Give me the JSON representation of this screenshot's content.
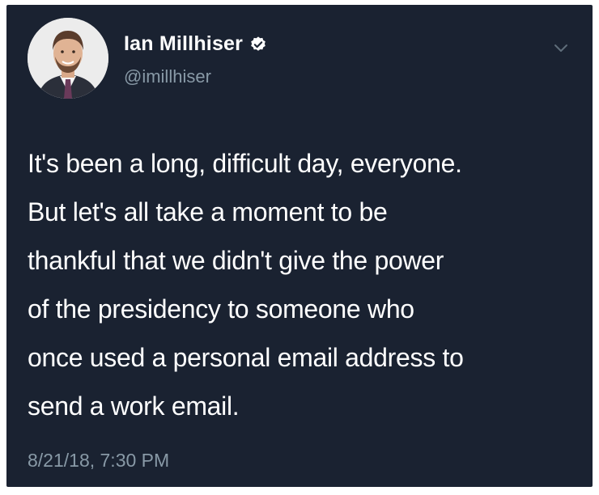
{
  "tweet": {
    "author": {
      "name": "Ian Millhiser",
      "handle": "@imillhiser",
      "verified": true,
      "avatar_icon": "profile-photo"
    },
    "text_lines": [
      "It's been a long, difficult day, everyone.",
      "But let's all take a moment to be",
      "thankful that we didn't give the power",
      "of the presidency to someone who",
      "once used a personal email address to",
      "send a work email."
    ],
    "timestamp": "8/21/18, 7:30 PM",
    "menu_icon": "chevron-down-icon"
  },
  "colors": {
    "background": "#1a2231",
    "text": "#ffffff",
    "secondary_text": "#8899a6",
    "verified_badge": "#ffffff"
  }
}
